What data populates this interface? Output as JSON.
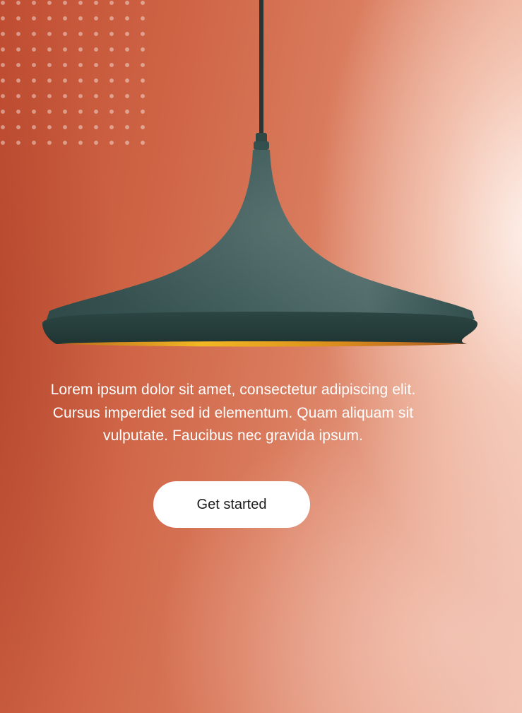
{
  "hero": {
    "background_colors": {
      "warm_orange": "#c55a3c",
      "light_glow": "#f3d4c8"
    },
    "illustration": "pendant-lamp",
    "decoration": "dot-grid-pattern"
  },
  "content": {
    "description": "Lorem ipsum dolor sit amet, consectetur adipiscing elit. Cursus imperdiet sed id elementum. Quam aliquam sit vulputate. Faucibus nec gravida ipsum."
  },
  "cta": {
    "label": "Get started",
    "background": "#ffffff",
    "text_color": "#1c1c1c"
  }
}
